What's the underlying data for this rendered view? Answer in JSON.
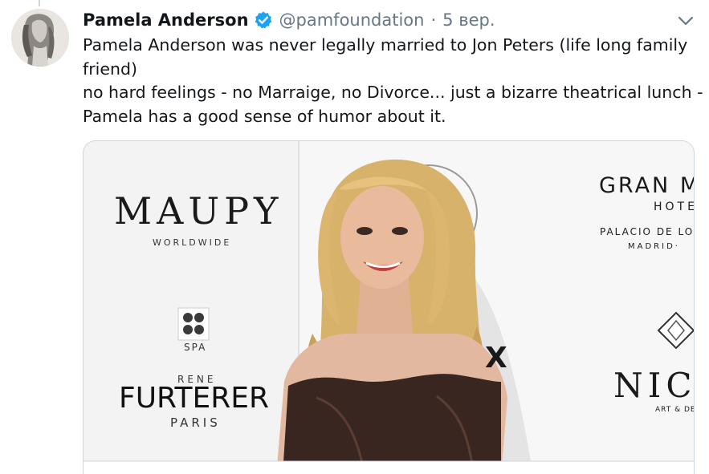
{
  "tweet": {
    "display_name": "Pamela Anderson",
    "handle": "@pamfoundation",
    "separator": "·",
    "date": "5 вер.",
    "verified": true,
    "text_lines": [
      "Pamela Anderson was never legally married to Jon Peters (life long family",
      "friend)",
      "no hard feelings - no Marraige, no Divorce... just a bizarre theatrical lunch -",
      "Pamela has a good sense of humor about it."
    ]
  },
  "media": {
    "backdrop_text": {
      "maupy": "MAUPY",
      "maupy_sub": "WORLDWIDE",
      "spa": "SPA",
      "rene": "RENE",
      "furterer": "FURTERER",
      "paris": "PARIS",
      "gran": "GRAN M",
      "hotel": "HOTE",
      "palacio": "PALACIO DE LO",
      "madrid": "MADRID·",
      "nic": "NIC",
      "art_de": "ART & DE",
      "x_mark": "X"
    }
  },
  "icons": {
    "verified": "verified-badge-icon",
    "caret": "chevron-down-icon"
  },
  "colors": {
    "name": "#14171a",
    "secondary": "#657786",
    "verified_blue": "#1da1f2",
    "border": "#ccd6dd"
  }
}
